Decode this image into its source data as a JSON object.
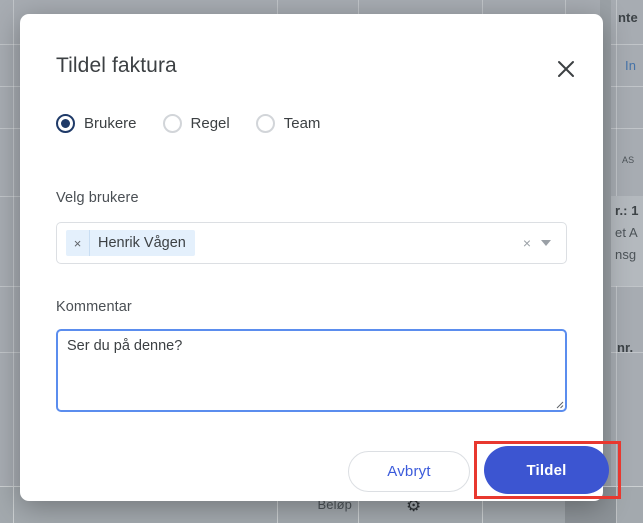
{
  "dialog": {
    "title": "Tildel faktura",
    "close_icon": "close-icon",
    "radio_group": {
      "options": [
        {
          "label": "Brukere",
          "selected": true
        },
        {
          "label": "Regel",
          "selected": false
        },
        {
          "label": "Team",
          "selected": false
        }
      ]
    },
    "users_field": {
      "label": "Velg brukere",
      "chips": [
        {
          "label": "Henrik Vågen",
          "remove_icon": "×"
        }
      ],
      "clear_icon": "×",
      "caret_icon": "chevron-down-icon"
    },
    "comment_field": {
      "label": "Kommentar",
      "value": "Ser du på denne?",
      "placeholder": ""
    },
    "footer": {
      "cancel_label": "Avbryt",
      "assign_label": "Tildel",
      "assign_highlight_color": "#e8382f"
    }
  },
  "background": {
    "fragments": {
      "top_right_1": "nte",
      "top_right_2": "In",
      "mid_1": "AS",
      "mid_2": "r.: 1",
      "mid_3": "et A",
      "mid_4": "nsg",
      "mid_5": "nr.",
      "bottom_column": "Beløp",
      "gear_icon": "gear-icon"
    }
  },
  "colors": {
    "primary_blue": "#3c55d1",
    "radio_navy": "#1f3a68",
    "focus_blue": "#5b8dee",
    "chip_bg": "#e4f0fc",
    "highlight_red": "#e8382f"
  }
}
